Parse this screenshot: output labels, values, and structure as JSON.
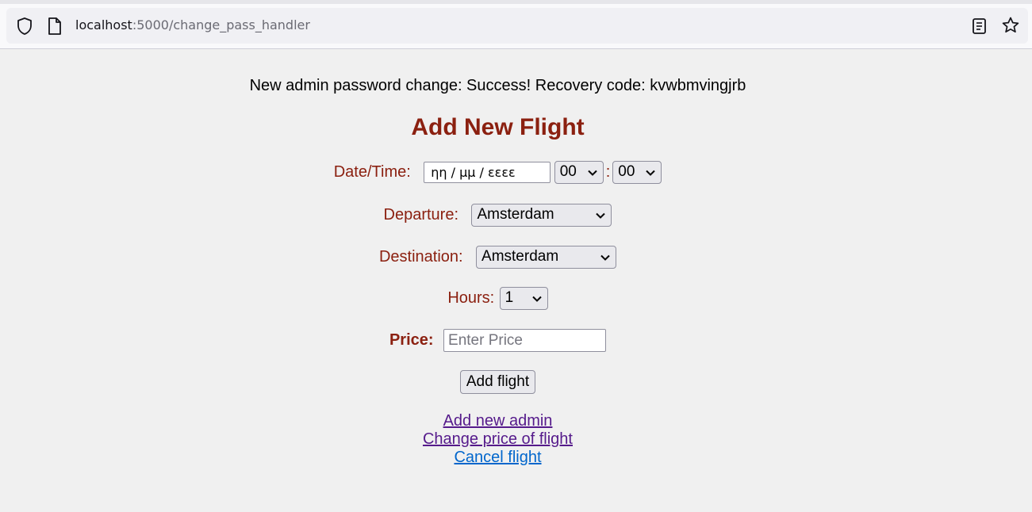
{
  "browser": {
    "url_host": "localhost",
    "url_path": ":5000/change_pass_handler"
  },
  "page": {
    "message": "New admin password change: Success! Recovery code: kvwbmvingjrb",
    "title": "Add New Flight",
    "date_time": {
      "label": "Date/Time:",
      "date_placeholder": "ηη / μμ / εεεε",
      "hour_value": "00",
      "separator": ":",
      "minute_value": "00"
    },
    "departure": {
      "label": "Departure:",
      "value": "Amsterdam"
    },
    "destination": {
      "label": "Destination:",
      "value": "Amsterdam"
    },
    "hours": {
      "label": "Hours:",
      "value": "1"
    },
    "price": {
      "label": "Price:",
      "placeholder": "Enter Price"
    },
    "add_button": "Add flight",
    "links": {
      "add_admin": "Add new admin",
      "change_price": "Change price of flight",
      "cancel_flight": "Cancel flight"
    },
    "colors": {
      "label_color": "#8b2010",
      "visited_link": "#551a8b",
      "link": "#0066cc"
    }
  }
}
